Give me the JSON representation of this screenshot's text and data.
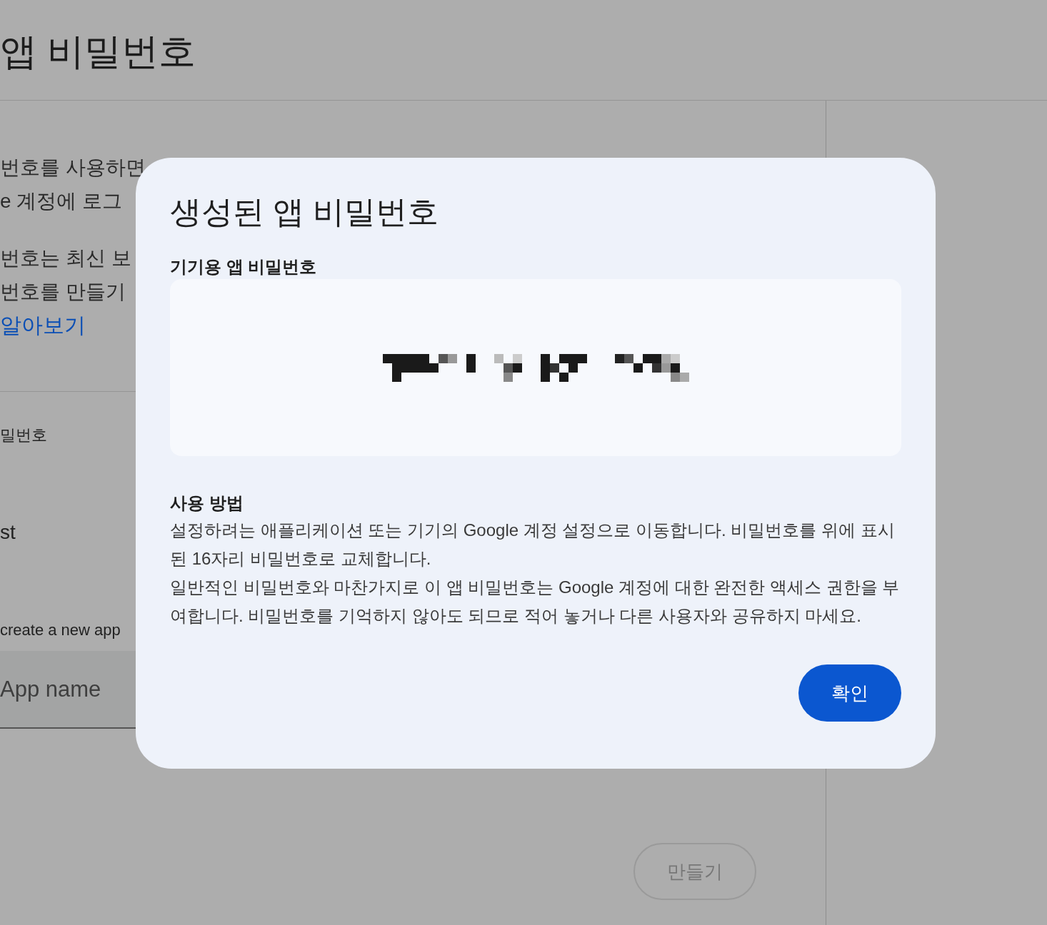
{
  "background": {
    "title": "앱 비밀번호",
    "intro_lines": [
      "번호를 사용하면",
      "e 계정에 로그"
    ],
    "notice_lines": [
      "번호는 최신 보",
      "번호를 만들기"
    ],
    "learn_more_link": "알아보기",
    "section_label": "밀번호",
    "app_name_partial": "st",
    "create_prompt": "create a new app",
    "app_name_field": {
      "placeholder": "App name"
    },
    "create_button": {
      "label": "만들기",
      "disabled": true
    }
  },
  "dialog": {
    "title": "생성된 앱 비밀번호",
    "password_label": "기기용 앱 비밀번호",
    "usage_heading": "사용 방법",
    "usage_paragraphs": [
      "설정하려는 애플리케이션 또는 기기의 Google 계정 설정으로 이동합니다. 비밀번호를 위에 표시된 16자리 비밀번호로 교체합니다.",
      "일반적인 비밀번호와 마찬가지로 이 앱 비밀번호는 Google 계정에 대한 완전한 액세스 권한을 부여합니다. 비밀번호를 기억하지 않아도 되므로 적어 놓거나 다른 사용자와 공유하지 마세요."
    ],
    "confirm_button": "확인"
  }
}
